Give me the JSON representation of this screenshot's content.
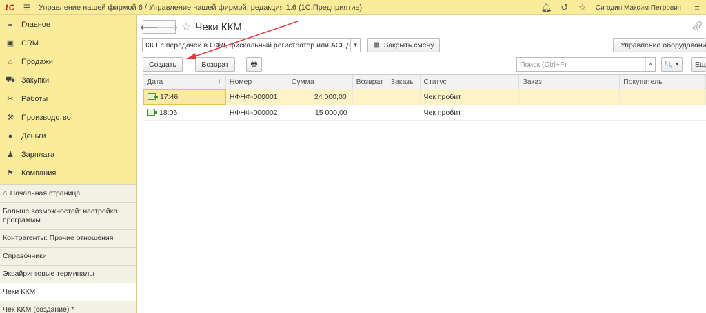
{
  "titlebar": {
    "logo": "1С",
    "title": "Управление нашей фирмой 6 / Управление нашей фирмой, редакция 1.6  (1С:Предприятие)",
    "user": "Сигодин Максим Петрович"
  },
  "sidebar": {
    "sections": [
      {
        "label": "Главное",
        "icon": "≡"
      },
      {
        "label": "CRM",
        "icon": "▣"
      },
      {
        "label": "Продажи",
        "icon": "⌂"
      },
      {
        "label": "Закупки",
        "icon": "⛟"
      },
      {
        "label": "Работы",
        "icon": "✂"
      },
      {
        "label": "Производство",
        "icon": "⚒"
      },
      {
        "label": "Деньги",
        "icon": "●"
      },
      {
        "label": "Зарплата",
        "icon": "♟"
      },
      {
        "label": "Компания",
        "icon": "⚑"
      }
    ],
    "open_windows": [
      "Начальная страница",
      "Больше возможностей: настройка программы",
      "Контрагенты: Прочие отношения",
      "Справочники",
      "Эквайринговые терминалы",
      "Чеки ККМ",
      "Чек ККМ (создание) *"
    ]
  },
  "form": {
    "title": "Чеки ККМ",
    "register_select": "ККТ с передачей в ОФД, фискальный регистратор или АСПД, п",
    "close_shift": "Закрыть смену",
    "equipment": "Управление оборудование",
    "create": "Создать",
    "return": "Возврат",
    "search_placeholder": "Поиск (Ctrl+F)",
    "more": "Ещ"
  },
  "table": {
    "columns": [
      "Дата",
      "Номер",
      "Сумма",
      "Возврат",
      "Заказы",
      "Статус",
      "Заказ",
      "Покупатель"
    ],
    "rows": [
      {
        "date": "17:46",
        "number": "НФНФ-000001",
        "sum": "24 000,00",
        "status": "Чек пробит"
      },
      {
        "date": "18:06",
        "number": "НФНФ-000002",
        "sum": "15 000,00",
        "status": "Чек пробит"
      }
    ]
  },
  "colors": {
    "accent": "#fbec9c",
    "selected_row": "#fdf3c7",
    "annotation_arrow": "#e0393e"
  }
}
